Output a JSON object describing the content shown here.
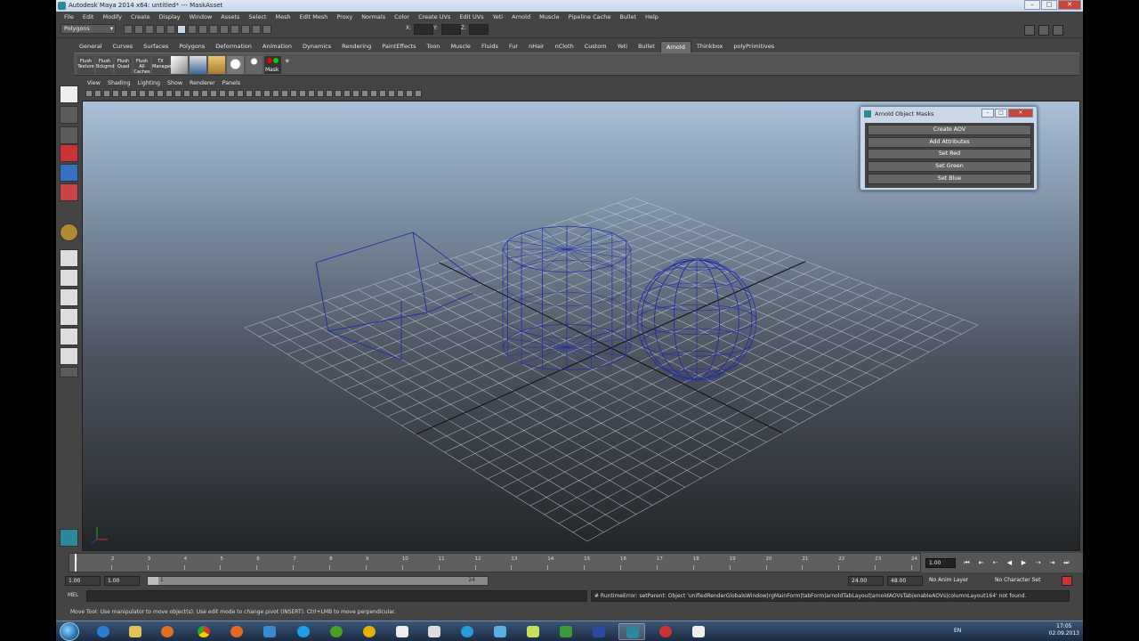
{
  "window": {
    "title": "Autodesk Maya 2014 x64: untitled*   ---   MaskAsset"
  },
  "menus": [
    "File",
    "Edit",
    "Modify",
    "Create",
    "Display",
    "Window",
    "Assets",
    "Select",
    "Mesh",
    "Edit Mesh",
    "Proxy",
    "Normals",
    "Color",
    "Create UVs",
    "Edit UVs",
    "Yeti",
    "Arnold",
    "Muscle",
    "Pipeline Cache",
    "Bullet",
    "Help"
  ],
  "status": {
    "mode": "Polygons",
    "x_label": "X:",
    "y_label": "Y:",
    "z_label": "Z:"
  },
  "shelf_tabs": [
    "General",
    "Curves",
    "Surfaces",
    "Polygons",
    "Deformation",
    "Animation",
    "Dynamics",
    "Rendering",
    "PaintEffects",
    "Toon",
    "Muscle",
    "Fluids",
    "Fur",
    "nHair",
    "nCloth",
    "Custom",
    "Yeti",
    "Bullet",
    "Arnold",
    "Thinkbox",
    "polyPrimitives"
  ],
  "shelf_active": "Arnold",
  "shelf_buttons": [
    {
      "label": "Flush Texture"
    },
    {
      "label": "Flush Bckgrnd"
    },
    {
      "label": "Flush Quad"
    },
    {
      "label": "Flush All Caches"
    },
    {
      "label": "TX Manager"
    }
  ],
  "mask_button": "Mask",
  "viewport_menus": [
    "View",
    "Shading",
    "Lighting",
    "Show",
    "Renderer",
    "Panels"
  ],
  "colors": {
    "wire": "#1f2ca8",
    "grid": "#c8d0dc"
  },
  "dialog": {
    "title": "Arnold Object Masks",
    "buttons": [
      "Create AOV",
      "Add Attributes",
      "Set Red",
      "Set Green",
      "Set Blue"
    ]
  },
  "timeline": {
    "ticks": [
      "1",
      "2",
      "3",
      "4",
      "5",
      "6",
      "7",
      "8",
      "9",
      "10",
      "11",
      "12",
      "13",
      "14",
      "15",
      "16",
      "17",
      "18",
      "19",
      "20",
      "21",
      "22",
      "23",
      "24"
    ],
    "current": "1.00"
  },
  "range": {
    "start": "1.00",
    "start2": "1.00",
    "slider_start": "1",
    "slider_end": "24",
    "end": "24.00",
    "end2": "48.00",
    "anim_layer": "No Anim Layer",
    "char_set": "No Character Set"
  },
  "cmd": {
    "label": "MEL",
    "error": "# RuntimeError: setParent: Object 'unifiedRenderGlobalsWindow|rgMainForm|tabForm|arnoldTabLayout|arnoldAOVsTab|enableAOVs|columnLayout164' not found."
  },
  "helpline": "Move Tool: Use manipulator to move object(s). Use edit mode to change pivot (INSERT).  Ctrl+LMB to move perpendicular.",
  "taskbar": {
    "lang": "EN",
    "time": "17:05",
    "date": "02.09.2013"
  }
}
